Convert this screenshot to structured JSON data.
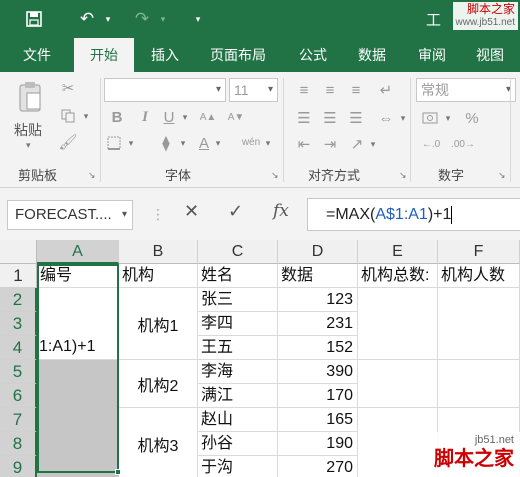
{
  "title_bar": {
    "title": "工",
    "save_icon": "save-icon",
    "undo_icon": "undo-icon",
    "redo_icon": "redo-icon",
    "customize_icon": "customize-qat-icon"
  },
  "watermark_top": {
    "line1": "脚本之家",
    "line2": "www.jb51.net"
  },
  "tabs": [
    {
      "label": "文件",
      "active": false
    },
    {
      "label": "开始",
      "active": true
    },
    {
      "label": "插入",
      "active": false
    },
    {
      "label": "页面布局",
      "active": false
    },
    {
      "label": "公式",
      "active": false
    },
    {
      "label": "数据",
      "active": false
    },
    {
      "label": "审阅",
      "active": false
    },
    {
      "label": "视图",
      "active": false
    }
  ],
  "ribbon": {
    "clipboard": {
      "label": "剪贴板",
      "paste_label": "粘贴"
    },
    "font": {
      "label": "字体",
      "font_name": "",
      "font_size": "11",
      "bold": "B",
      "italic": "I",
      "underline": "U",
      "phonetic": "wén"
    },
    "alignment": {
      "label": "对齐方式"
    },
    "number": {
      "label": "数字",
      "format": "常规",
      "percent": "%"
    }
  },
  "formula_bar": {
    "name_box": "FORECAST....",
    "fx_label": "fx",
    "formula_prefix": "=MAX(",
    "formula_ref": "A$1:A1",
    "formula_suffix": ")+1"
  },
  "sheet": {
    "columns": [
      "A",
      "B",
      "C",
      "D",
      "E",
      "F"
    ],
    "rows": [
      "1",
      "2",
      "3",
      "4",
      "5",
      "6",
      "7",
      "8",
      "9"
    ],
    "header_row": [
      "编号",
      "机构",
      "姓名",
      "数据",
      "机构总数:",
      "机构人数"
    ],
    "a4_text": "1:A1)+1",
    "groups": [
      {
        "org": "机构1",
        "members": [
          {
            "name": "张三",
            "value": "123"
          },
          {
            "name": "李四",
            "value": "231"
          },
          {
            "name": "王五",
            "value": "152"
          }
        ]
      },
      {
        "org": "机构2",
        "members": [
          {
            "name": "李海",
            "value": "390"
          },
          {
            "name": "满江",
            "value": "170"
          }
        ]
      },
      {
        "org": "机构3",
        "members": [
          {
            "name": "赵山",
            "value": "165"
          },
          {
            "name": "孙谷",
            "value": "190"
          },
          {
            "name": "于沟",
            "value": "270"
          }
        ]
      }
    ]
  },
  "watermark_bottom": {
    "url": "jb51.net",
    "name": "脚本之家"
  },
  "colors": {
    "accent": "#217346",
    "selection_fill": "#c6c6c6",
    "reference_blue": "#1f5fbf"
  }
}
